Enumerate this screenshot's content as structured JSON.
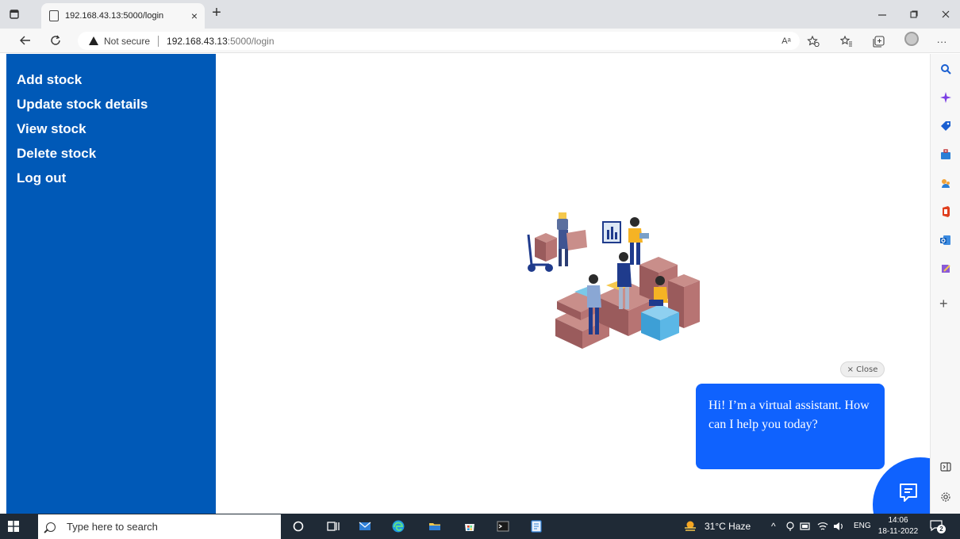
{
  "browser": {
    "tab_title": "192.168.43.13:5000/login",
    "tab_close": "×",
    "new_tab": "+",
    "security_label": "Not secure",
    "url_host": "192.168.43.13",
    "url_path": ":5000/login",
    "read_aloud": "Aᵃ",
    "more": "···"
  },
  "sidebar": {
    "items": [
      {
        "label": "Add stock"
      },
      {
        "label": "Update stock details"
      },
      {
        "label": "View stock"
      },
      {
        "label": "Delete stock"
      },
      {
        "label": "Log out"
      }
    ]
  },
  "chat": {
    "close_label": "× Close",
    "message": "Hi! I’m a virtual assistant. How can I help you today?"
  },
  "taskbar": {
    "search_placeholder": "Type here to search",
    "weather": "31°C Haze",
    "language": "ENG",
    "time": "14:06",
    "date": "18-11-2022",
    "notification_count": "2"
  },
  "colors": {
    "sidebar_bg": "#0059b7",
    "chat_blue": "#0f62fe",
    "taskbar_bg": "#1f2a36"
  }
}
